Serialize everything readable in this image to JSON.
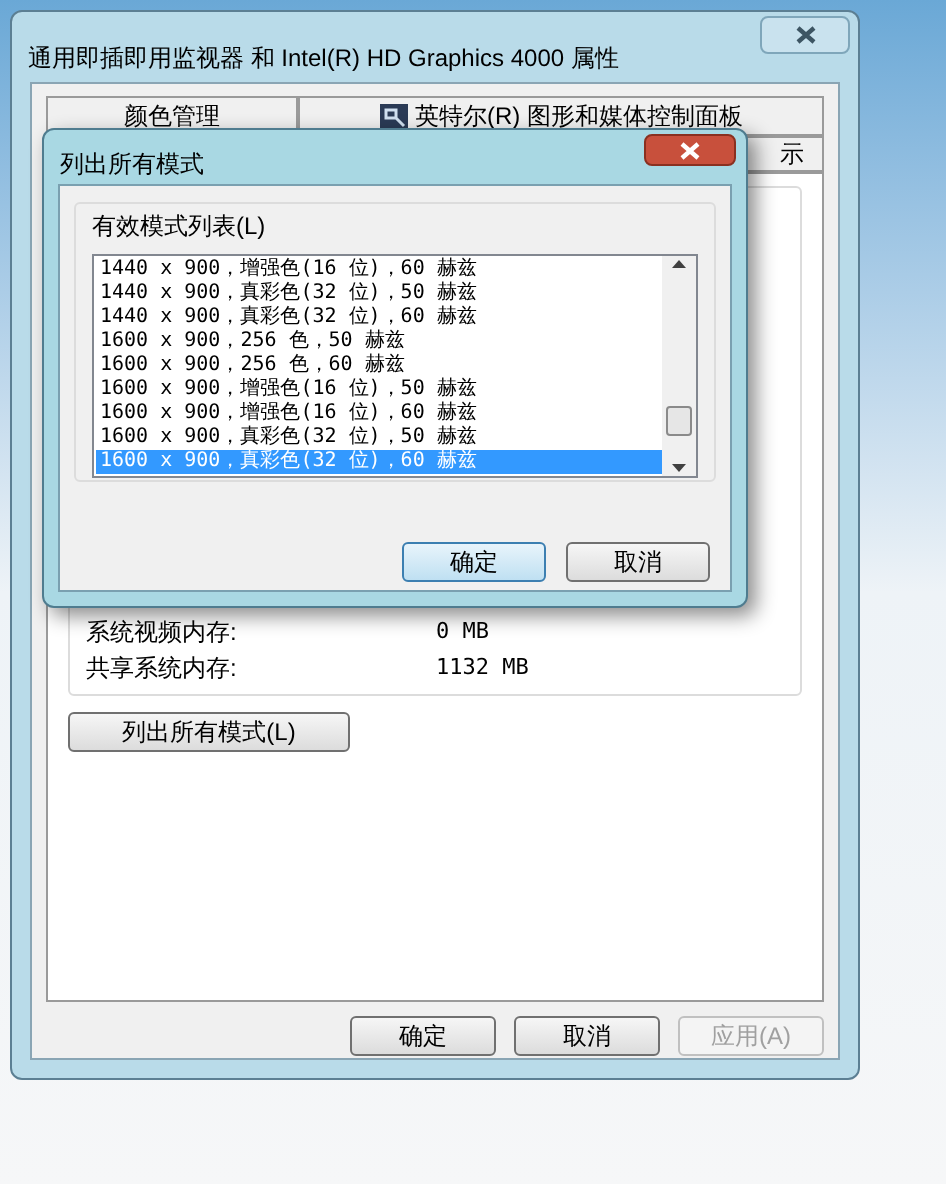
{
  "window": {
    "title": "通用即插即用监视器 和 Intel(R) HD Graphics 4000 属性"
  },
  "tabs_row_1": [
    {
      "label": "颜色管理",
      "selected": false
    },
    {
      "label": "英特尔(R) 图形和媒体控制面板",
      "selected": false
    }
  ],
  "tabs_row_2": [
    {
      "label": "示",
      "selected": false
    }
  ],
  "memory": [
    {
      "label": "系统视频内存:",
      "value": "0 MB"
    },
    {
      "label": "共享系统内存:",
      "value": "1132 MB"
    }
  ],
  "list_modes_button": "列出所有模式(L)",
  "buttons": [
    {
      "label": "确定",
      "disabled": false
    },
    {
      "label": "取消",
      "disabled": false
    },
    {
      "label": "应用(A)",
      "disabled": true
    }
  ],
  "modal": {
    "title": "列出所有模式",
    "group_label": "有效模式列表(L)",
    "modes": [
      {
        "text": "1440 x 900，增强色(16 位)，60 赫兹",
        "selected": false
      },
      {
        "text": "1440 x 900，真彩色(32 位)，50 赫兹",
        "selected": false
      },
      {
        "text": "1440 x 900，真彩色(32 位)，60 赫兹",
        "selected": false
      },
      {
        "text": "1600 x 900，256 色，50 赫兹",
        "selected": false
      },
      {
        "text": "1600 x 900，256 色，60 赫兹",
        "selected": false
      },
      {
        "text": "1600 x 900，增强色(16 位)，50 赫兹",
        "selected": false
      },
      {
        "text": "1600 x 900，增强色(16 位)，60 赫兹",
        "selected": false
      },
      {
        "text": "1600 x 900，真彩色(32 位)，50 赫兹",
        "selected": false
      },
      {
        "text": "1600 x 900，真彩色(32 位)，60 赫兹",
        "selected": true
      }
    ],
    "buttons": [
      {
        "label": "确定",
        "default": true
      },
      {
        "label": "取消",
        "default": false
      }
    ]
  }
}
